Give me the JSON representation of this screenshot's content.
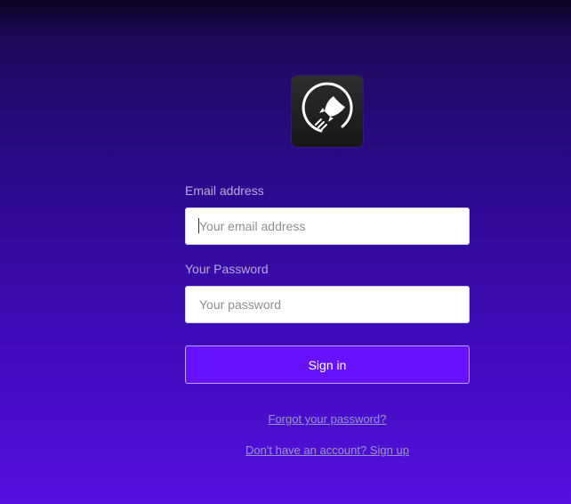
{
  "logo": {
    "icon": "rocket-icon"
  },
  "form": {
    "email_label": "Email address",
    "email_placeholder": "Your email address",
    "email_value": "",
    "password_label": "Your Password",
    "password_placeholder": "Your password",
    "password_value": "",
    "submit_label": "Sign in"
  },
  "links": {
    "forgot_password": "Forgot your password?",
    "sign_up": "Don't have an account? Sign up"
  },
  "colors": {
    "accent": "#6611ff",
    "background_top": "#1d0858",
    "background_bottom": "#5410df",
    "link": "#9f93d1"
  }
}
